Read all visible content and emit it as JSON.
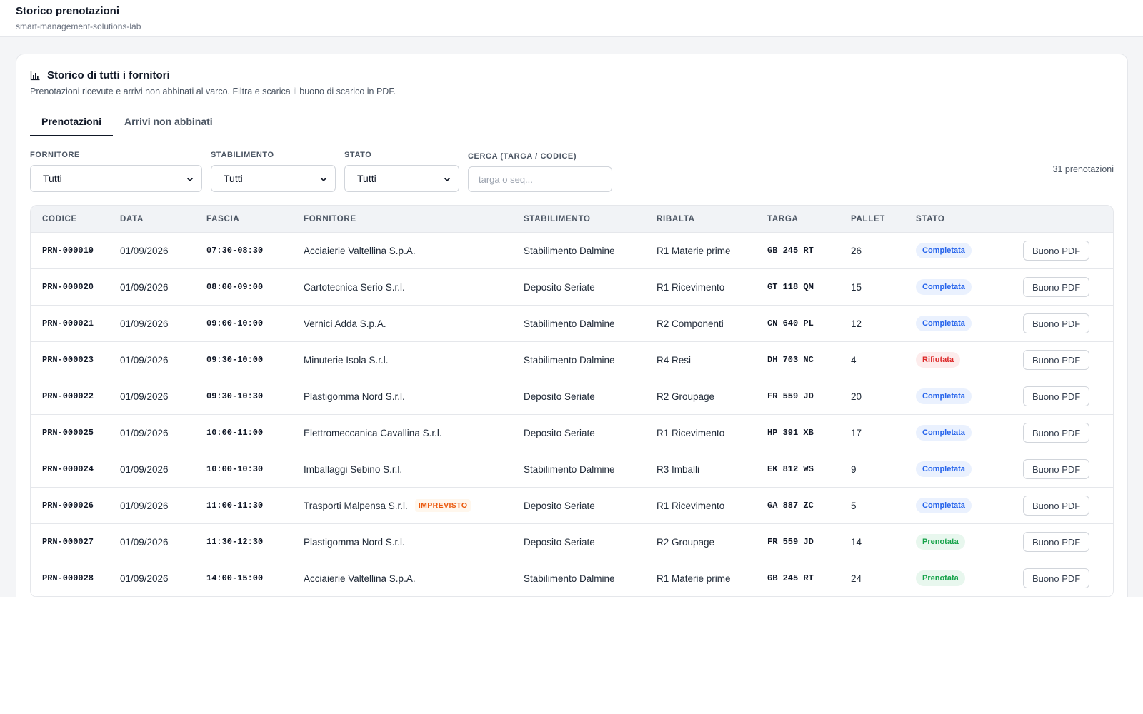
{
  "header": {
    "title": "Storico prenotazioni",
    "subtitle": "smart-management-solutions-lab"
  },
  "card": {
    "title": "Storico di tutti i fornitori",
    "description": "Prenotazioni ricevute e arrivi non abbinati al varco. Filtra e scarica il buono di scarico in PDF.",
    "icon": "bar-chart-icon"
  },
  "tabs": [
    {
      "label": "Prenotazioni",
      "active": true
    },
    {
      "label": "Arrivi non abbinati",
      "active": false
    }
  ],
  "filters": {
    "fornitore": {
      "label": "FORNITORE",
      "value": "Tutti"
    },
    "stabilimento": {
      "label": "STABILIMENTO",
      "value": "Tutti"
    },
    "stato": {
      "label": "STATO",
      "value": "Tutti"
    },
    "search": {
      "label": "CERCA (TARGA / CODICE)",
      "placeholder": "targa o seq..."
    },
    "count": "31 prenotazioni"
  },
  "table": {
    "columns": [
      "CODICE",
      "DATA",
      "FASCIA",
      "FORNITORE",
      "STABILIMENTO",
      "RIBALTA",
      "TARGA",
      "PALLET",
      "STATO",
      ""
    ],
    "rows": [
      {
        "codice": "PRN-000019",
        "data": "01/09/2026",
        "fascia": "07:30-08:30",
        "fornitore": "Acciaierie Valtellina S.p.A.",
        "flag": "",
        "stabilimento": "Stabilimento Dalmine",
        "ribalta": "R1 Materie prime",
        "targa": "GB 245 RT",
        "pallet": "26",
        "stato": "Completata",
        "action": "Buono PDF"
      },
      {
        "codice": "PRN-000020",
        "data": "01/09/2026",
        "fascia": "08:00-09:00",
        "fornitore": "Cartotecnica Serio S.r.l.",
        "flag": "",
        "stabilimento": "Deposito Seriate",
        "ribalta": "R1 Ricevimento",
        "targa": "GT 118 QM",
        "pallet": "15",
        "stato": "Completata",
        "action": "Buono PDF"
      },
      {
        "codice": "PRN-000021",
        "data": "01/09/2026",
        "fascia": "09:00-10:00",
        "fornitore": "Vernici Adda S.p.A.",
        "flag": "",
        "stabilimento": "Stabilimento Dalmine",
        "ribalta": "R2 Componenti",
        "targa": "CN 640 PL",
        "pallet": "12",
        "stato": "Completata",
        "action": "Buono PDF"
      },
      {
        "codice": "PRN-000023",
        "data": "01/09/2026",
        "fascia": "09:30-10:00",
        "fornitore": "Minuterie Isola S.r.l.",
        "flag": "",
        "stabilimento": "Stabilimento Dalmine",
        "ribalta": "R4 Resi",
        "targa": "DH 703 NC",
        "pallet": "4",
        "stato": "Rifiutata",
        "action": "Buono PDF"
      },
      {
        "codice": "PRN-000022",
        "data": "01/09/2026",
        "fascia": "09:30-10:30",
        "fornitore": "Plastigomma Nord S.r.l.",
        "flag": "",
        "stabilimento": "Deposito Seriate",
        "ribalta": "R2 Groupage",
        "targa": "FR 559 JD",
        "pallet": "20",
        "stato": "Completata",
        "action": "Buono PDF"
      },
      {
        "codice": "PRN-000025",
        "data": "01/09/2026",
        "fascia": "10:00-11:00",
        "fornitore": "Elettromeccanica Cavallina S.r.l.",
        "flag": "",
        "stabilimento": "Deposito Seriate",
        "ribalta": "R1 Ricevimento",
        "targa": "HP 391 XB",
        "pallet": "17",
        "stato": "Completata",
        "action": "Buono PDF"
      },
      {
        "codice": "PRN-000024",
        "data": "01/09/2026",
        "fascia": "10:00-10:30",
        "fornitore": "Imballaggi Sebino S.r.l.",
        "flag": "",
        "stabilimento": "Stabilimento Dalmine",
        "ribalta": "R3 Imballi",
        "targa": "EK 812 WS",
        "pallet": "9",
        "stato": "Completata",
        "action": "Buono PDF"
      },
      {
        "codice": "PRN-000026",
        "data": "01/09/2026",
        "fascia": "11:00-11:30",
        "fornitore": "Trasporti Malpensa S.r.l.",
        "flag": "IMPREVISTO",
        "stabilimento": "Deposito Seriate",
        "ribalta": "R1 Ricevimento",
        "targa": "GA 887 ZC",
        "pallet": "5",
        "stato": "Completata",
        "action": "Buono PDF"
      },
      {
        "codice": "PRN-000027",
        "data": "01/09/2026",
        "fascia": "11:30-12:30",
        "fornitore": "Plastigomma Nord S.r.l.",
        "flag": "",
        "stabilimento": "Deposito Seriate",
        "ribalta": "R2 Groupage",
        "targa": "FR 559 JD",
        "pallet": "14",
        "stato": "Prenotata",
        "action": "Buono PDF"
      },
      {
        "codice": "PRN-000028",
        "data": "01/09/2026",
        "fascia": "14:00-15:00",
        "fornitore": "Acciaierie Valtellina S.p.A.",
        "flag": "",
        "stabilimento": "Stabilimento Dalmine",
        "ribalta": "R1 Materie prime",
        "targa": "GB 245 RT",
        "pallet": "24",
        "stato": "Prenotata",
        "action": "Buono PDF"
      }
    ]
  },
  "colors": {
    "completata": "#2563eb",
    "rifiutata": "#dc2626",
    "prenotata": "#16a34a",
    "imprevisto": "#ea580c"
  }
}
